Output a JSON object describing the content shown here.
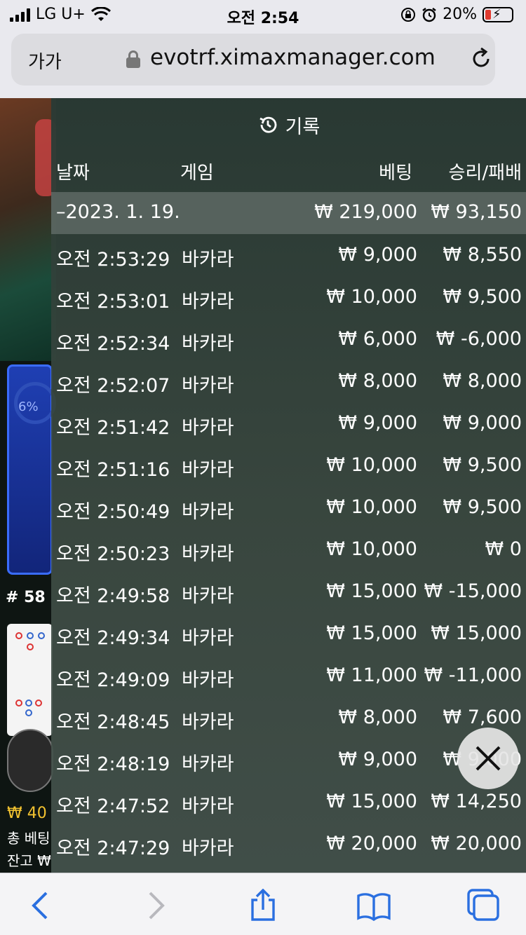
{
  "status_bar": {
    "carrier": "LG U+",
    "time": "오전 2:54",
    "battery_percent": "20%"
  },
  "browser": {
    "text_size_button": "가가",
    "url": "evotrf.ximaxmanager.com"
  },
  "background_page": {
    "progress_label": "6%",
    "round_label": "# 58",
    "bet_amount": "₩ 40",
    "total_bet_label": "총 베팅",
    "balance_label": "잔고 ₩"
  },
  "history": {
    "title": "기록",
    "columns": {
      "date": "날짜",
      "game": "게임",
      "bet": "베팅",
      "result": "승리/패배"
    },
    "summary": {
      "date": "–2023. 1. 19.",
      "bet": "₩ 219,000",
      "result": "₩ 93,150"
    },
    "rows": [
      {
        "time": "오전 2:53:29",
        "game": "바카라",
        "bet": "₩ 9,000",
        "result": "₩ 8,550"
      },
      {
        "time": "오전 2:53:01",
        "game": "바카라",
        "bet": "₩ 10,000",
        "result": "₩ 9,500"
      },
      {
        "time": "오전 2:52:34",
        "game": "바카라",
        "bet": "₩ 6,000",
        "result": "₩ -6,000"
      },
      {
        "time": "오전 2:52:07",
        "game": "바카라",
        "bet": "₩ 8,000",
        "result": "₩ 8,000"
      },
      {
        "time": "오전 2:51:42",
        "game": "바카라",
        "bet": "₩ 9,000",
        "result": "₩ 9,000"
      },
      {
        "time": "오전 2:51:16",
        "game": "바카라",
        "bet": "₩ 10,000",
        "result": "₩ 9,500"
      },
      {
        "time": "오전 2:50:49",
        "game": "바카라",
        "bet": "₩ 10,000",
        "result": "₩ 9,500"
      },
      {
        "time": "오전 2:50:23",
        "game": "바카라",
        "bet": "₩ 10,000",
        "result": "₩ 0"
      },
      {
        "time": "오전 2:49:58",
        "game": "바카라",
        "bet": "₩ 15,000",
        "result": "₩ -15,000"
      },
      {
        "time": "오전 2:49:34",
        "game": "바카라",
        "bet": "₩ 15,000",
        "result": "₩ 15,000"
      },
      {
        "time": "오전 2:49:09",
        "game": "바카라",
        "bet": "₩ 11,000",
        "result": "₩ -11,000"
      },
      {
        "time": "오전 2:48:45",
        "game": "바카라",
        "bet": "₩ 8,000",
        "result": "₩ 7,600"
      },
      {
        "time": "오전 2:48:19",
        "game": "바카라",
        "bet": "₩ 9,000",
        "result": "₩ 9,000"
      },
      {
        "time": "오전 2:47:52",
        "game": "바카라",
        "bet": "₩ 15,000",
        "result": "₩ 14,250"
      },
      {
        "time": "오전 2:47:29",
        "game": "바카라",
        "bet": "₩ 20,000",
        "result": "₩ 20,000"
      }
    ]
  },
  "toolbar_icons": [
    "back-icon",
    "forward-icon",
    "share-icon",
    "bookmarks-icon",
    "tabs-icon"
  ]
}
